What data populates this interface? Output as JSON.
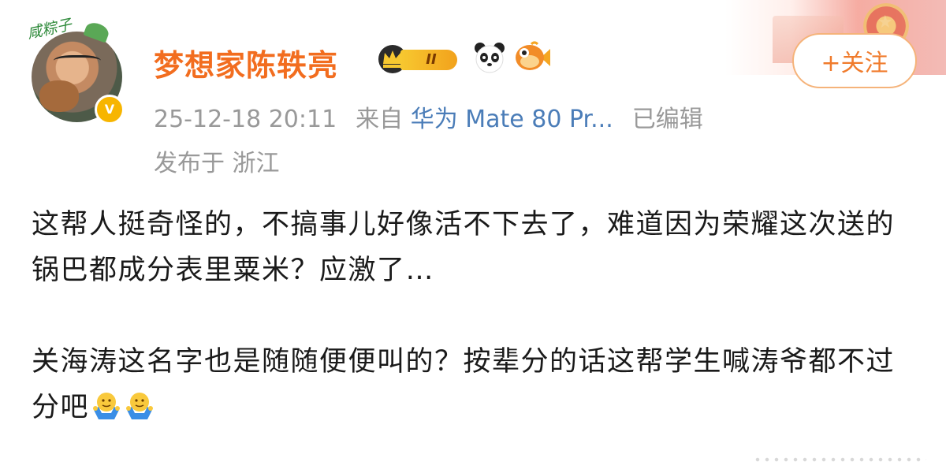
{
  "post": {
    "author": {
      "name": "梦想家陈轶亮",
      "avatar_tag": "咸粽子",
      "verified_badge_glyph": "V",
      "vip_level": "II"
    },
    "follow_button_label": "+关注",
    "timestamp": "25-12-18 20:11",
    "source_prefix": "来自",
    "device": "华为 Mate 80 Pr...",
    "edited_label": "已编辑",
    "location": "发布于 浙江",
    "paragraphs": [
      "这帮人挺奇怪的，不搞事儿好像活不下去了，难道因为荣耀这次送的锅巴都成分表里粟米？应激了…",
      "关海涛这名字也是随随便便叫的？按辈分的话这帮学生喊涛爷都不过分吧"
    ]
  },
  "icons": {
    "crown": "crown-badge-icon",
    "panda": "panda-icon",
    "fish": "fish-icon",
    "emoji": "shrug-emoji-icon"
  },
  "colors": {
    "username": "#f26d1f",
    "device_link": "#4b7db8",
    "follow_border": "#f5b37a",
    "follow_text": "#f07b2c",
    "verified": "#f7b500",
    "meta": "#999999"
  }
}
